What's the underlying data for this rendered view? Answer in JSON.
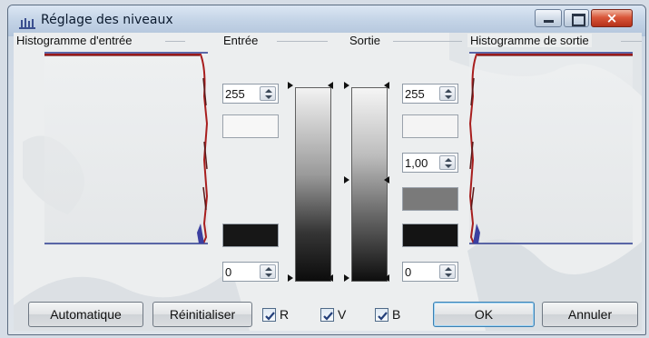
{
  "window": {
    "title": "Réglage des niveaux",
    "close_glyph": "×"
  },
  "groups": {
    "input_histogram": "Histogramme d'entrée",
    "input": "Entrée",
    "output": "Sortie",
    "output_histogram": "Histogramme de sortie"
  },
  "input": {
    "high_value": "255",
    "low_value": "0",
    "high_color": "#f7f7f7",
    "low_color": "#171717"
  },
  "output": {
    "high_value": "255",
    "gamma_value": "1,00",
    "low_value": "0",
    "high_color": "#f4f4f4",
    "mid_color": "#7a7a7a",
    "low_color": "#141414"
  },
  "buttons": {
    "auto": "Automatique",
    "reset": "Réinitialiser",
    "ok": "OK",
    "cancel": "Annuler"
  },
  "channels": [
    {
      "label": "R",
      "checked": true
    },
    {
      "label": "V",
      "checked": true
    },
    {
      "label": "B",
      "checked": true
    }
  ],
  "icons": {
    "title": "levels-icon",
    "minimize": "minimize-icon",
    "maximize": "maximize-icon",
    "close": "close-icon"
  }
}
